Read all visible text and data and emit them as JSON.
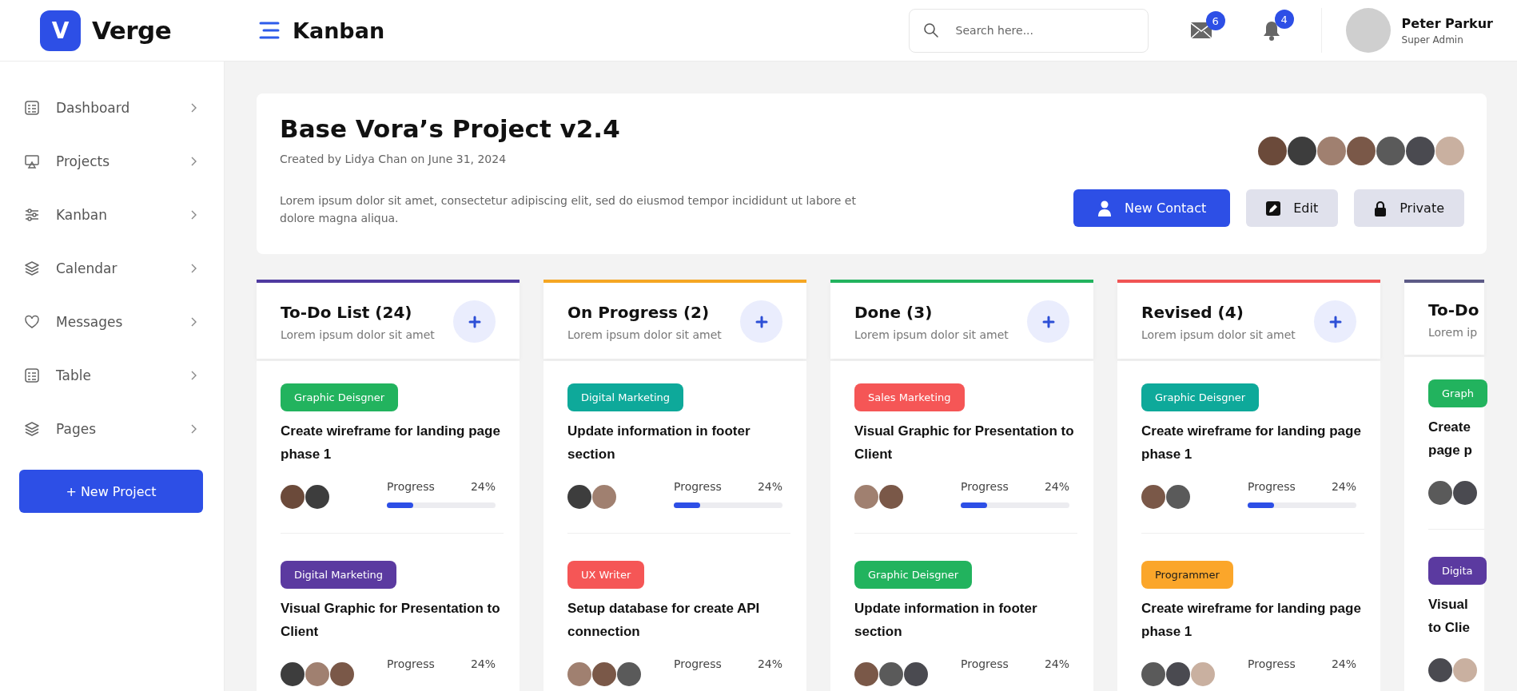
{
  "header": {
    "logo": {
      "mark": "V",
      "name": "Verge"
    },
    "page_title": "Kanban",
    "search": {
      "placeholder": "Search here..."
    },
    "notifications": [
      {
        "kind": "mail",
        "badge": "6"
      },
      {
        "kind": "bell",
        "badge": "4"
      }
    ],
    "user": {
      "name": "Peter Parkur",
      "role": "Super Admin"
    }
  },
  "sidebar": {
    "items": [
      {
        "label": "Dashboard"
      },
      {
        "label": "Projects"
      },
      {
        "label": "Kanban"
      },
      {
        "label": "Calendar"
      },
      {
        "label": "Messages"
      },
      {
        "label": "Table"
      },
      {
        "label": "Pages"
      }
    ],
    "new_project": "+ New Project"
  },
  "project": {
    "title": "Base Vora’s Project v2.4",
    "meta": "Created by Lidya Chan on June 31, 2024",
    "description": "Lorem ipsum dolor sit amet, consectetur adipiscing elit, sed do eiusmod tempor incididunt ut labore et dolore magna aliqua.",
    "members": [
      {
        "kind": "photo"
      },
      {
        "kind": "photo"
      },
      {
        "kind": "photo"
      },
      {
        "kind": "photo"
      },
      {
        "kind": "photo"
      },
      {
        "kind": "photo"
      },
      {
        "kind": "photo"
      }
    ],
    "buttons": [
      {
        "label": "New Contact",
        "kind": "primary"
      },
      {
        "label": "Edit",
        "kind": "secondary"
      },
      {
        "label": "Private",
        "kind": "secondary"
      }
    ]
  },
  "columns": [
    {
      "title": "To-Do List (24)",
      "subtitle": "Lorem ipsum dolor sit amet",
      "color": "#4f3aa0",
      "add_button": true,
      "cards": [
        {
          "tag": "Graphic Deisgner",
          "color": "#22b35e",
          "title": "Create wireframe for landing page phase 1",
          "assignees": [
            {
              "kind": "photo"
            },
            {
              "kind": "photo"
            }
          ],
          "progress_label": "Progress",
          "progress_text": "24%",
          "level": 0.24
        },
        {
          "tag": "Digital Marketing",
          "color": "#5b3aa0",
          "title": "Visual Graphic for Presentation to Client",
          "assignees": [
            {
              "kind": "photo"
            },
            {
              "kind": "photo"
            },
            {
              "kind": "photo"
            }
          ],
          "progress_label": "Progress",
          "progress_text": "24%"
        }
      ]
    },
    {
      "title": "On Progress (2)",
      "subtitle": "Lorem ipsum dolor sit amet",
      "color": "#f5a623",
      "add_button": true,
      "cards": [
        {
          "tag": "Digital Marketing",
          "color": "#0ea99a",
          "title": "Update information in footer section",
          "assignees": [
            {
              "kind": "photo"
            },
            {
              "kind": "photo"
            }
          ],
          "progress_label": "Progress",
          "progress_text": "24%",
          "level": 0.24
        },
        {
          "tag": "UX Writer",
          "color": "#f55656",
          "title": "Setup database for create API connection",
          "assignees": [
            {
              "kind": "photo"
            },
            {
              "kind": "photo"
            },
            {
              "kind": "photo"
            }
          ],
          "progress_label": "Progress",
          "progress_text": "24%"
        }
      ]
    },
    {
      "title": "Done (3)",
      "subtitle": "Lorem ipsum dolor sit amet",
      "color": "#22b35e",
      "add_button": true,
      "cards": [
        {
          "tag": "Sales Marketing",
          "color": "#f55656",
          "title": "Visual Graphic for Presentation to Client",
          "assignees": [
            {
              "kind": "photo"
            },
            {
              "kind": "photo"
            }
          ],
          "progress_label": "Progress",
          "progress_text": "24%",
          "level": 0.24
        },
        {
          "tag": "Graphic Deisgner",
          "color": "#22b35e",
          "title": "Update information in footer section",
          "assignees": [
            {
              "kind": "photo"
            },
            {
              "kind": "photo"
            },
            {
              "kind": "photo"
            }
          ],
          "progress_label": "Progress",
          "progress_text": "24%"
        }
      ]
    },
    {
      "title": "Revised (4)",
      "subtitle": "Lorem ipsum dolor sit amet",
      "color": "#f05454",
      "add_button": true,
      "cards": [
        {
          "tag": "Graphic Deisgner",
          "color": "#0ea99a",
          "title": "Create wireframe for landing page phase 1",
          "assignees": [
            {
              "kind": "photo"
            },
            {
              "kind": "photo"
            }
          ],
          "progress_label": "Progress",
          "progress_text": "24%",
          "level": 0.24
        },
        {
          "tag": "Programmer",
          "color": "#fba62a",
          "title": "Create wireframe for landing page phase 1",
          "assignees": [
            {
              "kind": "photo"
            },
            {
              "kind": "photo"
            },
            {
              "kind": "photo"
            }
          ],
          "progress_label": "Progress",
          "progress_text": "24%"
        }
      ]
    },
    {
      "title": "To-Do",
      "subtitle": "Lorem ip",
      "color": "#5c5a86",
      "add_button": false,
      "cards": [
        {
          "tag": "Graph",
          "color": "#22b35e",
          "title": "Create page p",
          "assignees": [
            {
              "kind": "photo"
            },
            {
              "kind": "photo"
            }
          ]
        },
        {
          "tag": "Digita",
          "color": "#5b3aa0",
          "title": "Visual to Clie",
          "assignees": [
            {
              "kind": "photo"
            },
            {
              "kind": "photo"
            }
          ]
        }
      ]
    }
  ]
}
